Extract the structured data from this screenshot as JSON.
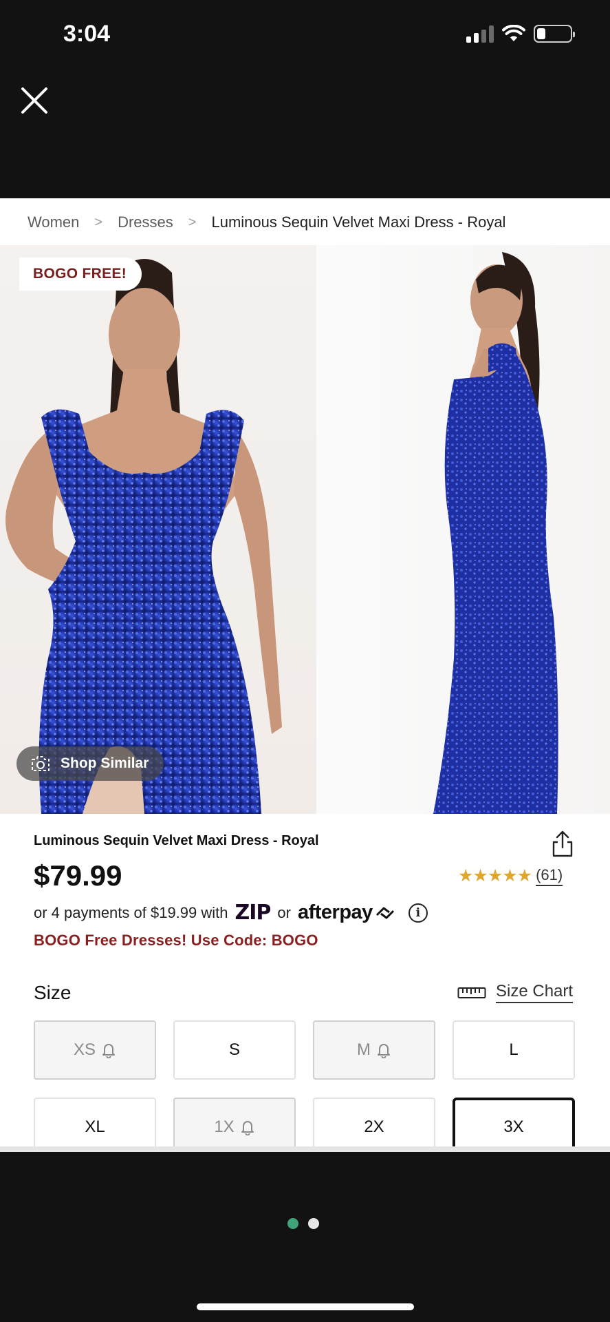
{
  "status_bar": {
    "time": "3:04",
    "signal_icon": "cellular-signal-icon",
    "wifi_icon": "wifi-icon",
    "battery_icon": "battery-icon"
  },
  "close_icon": "close-icon",
  "breadcrumb": {
    "items": [
      "Women",
      "Dresses",
      "Luminous Sequin Velvet Maxi Dress - Royal"
    ]
  },
  "gallery": {
    "badge": "BOGO FREE!",
    "shop_similar_label": "Shop Similar",
    "shop_similar_icon": "camera-icon"
  },
  "product": {
    "title": "Luminous Sequin Velvet Maxi Dress - Royal",
    "price": "$79.99",
    "rating_stars": "★★★★★",
    "review_count": "(61)",
    "installment_prefix": "or 4 payments of $19.99 with",
    "zip_logo": "ZIP",
    "installment_or": "or",
    "afterpay_logo": "afterpay",
    "promo": "BOGO Free Dresses! Use Code: BOGO"
  },
  "size": {
    "label": "Size",
    "chart_label": "Size Chart",
    "chart_icon": "ruler-icon",
    "options": [
      {
        "label": "XS",
        "available": false
      },
      {
        "label": "S",
        "available": true
      },
      {
        "label": "M",
        "available": false
      },
      {
        "label": "L",
        "available": true
      },
      {
        "label": "XL",
        "available": true
      },
      {
        "label": "1X",
        "available": false
      },
      {
        "label": "2X",
        "available": true
      },
      {
        "label": "3X",
        "available": true,
        "selected": true
      }
    ]
  },
  "pager": {
    "active_color": "#3fa37a",
    "inactive_color": "#e6e6e6"
  },
  "colors": {
    "promo": "#8a1f1f",
    "stars": "#e0a630",
    "dress": "#1f33a8"
  }
}
